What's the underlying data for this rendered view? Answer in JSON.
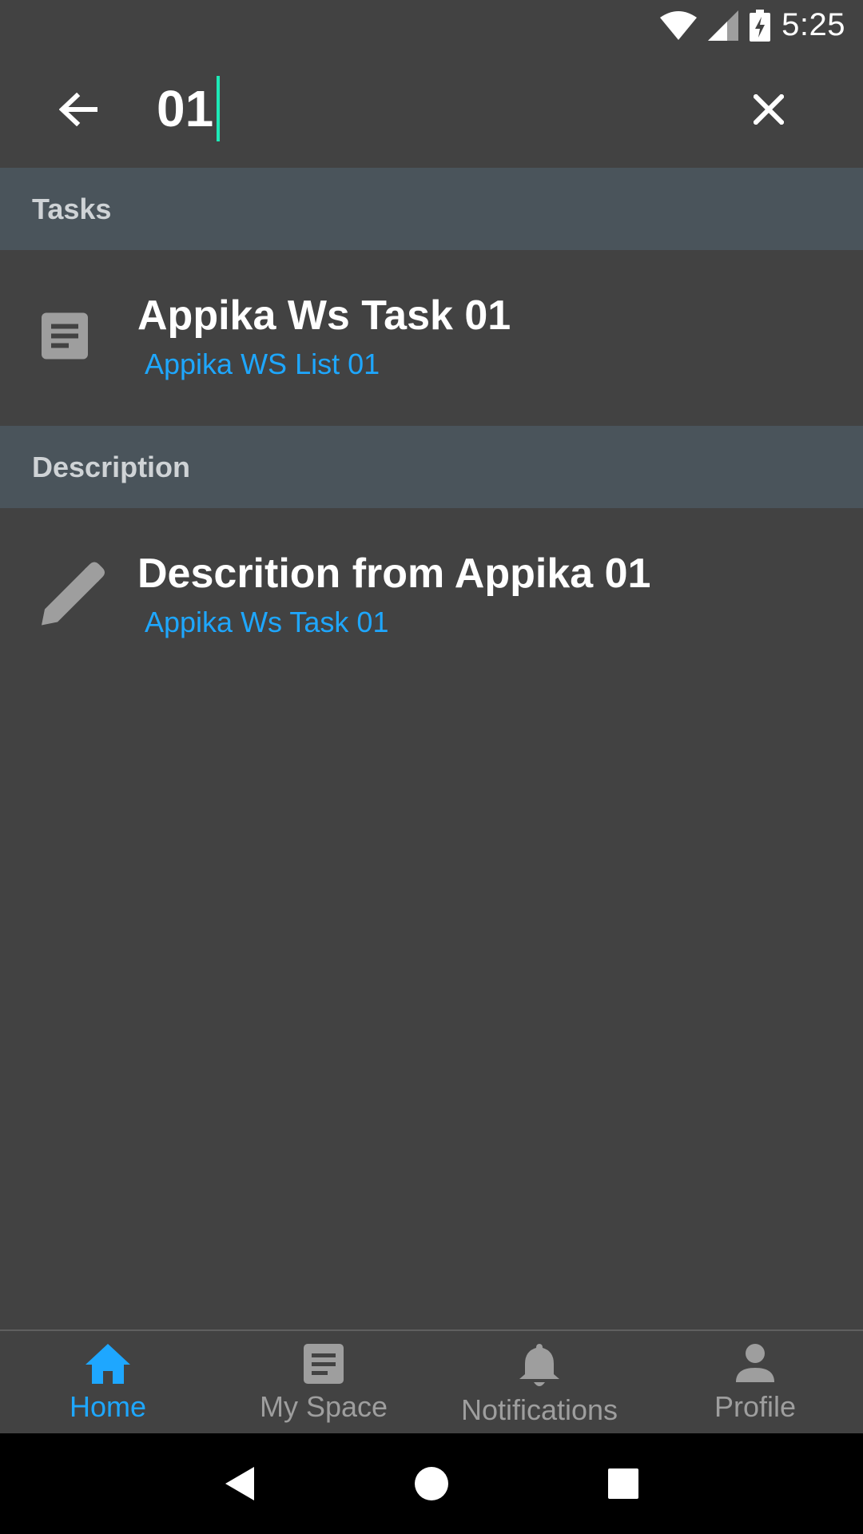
{
  "status_bar": {
    "time": "5:25"
  },
  "search": {
    "query": "01"
  },
  "sections": [
    {
      "header": "Tasks",
      "items": [
        {
          "title": "Appika Ws Task 01",
          "subtitle": "Appika WS List 01",
          "icon": "task-document-icon"
        }
      ]
    },
    {
      "header": "Description",
      "items": [
        {
          "title": "Descrition from Appika 01",
          "subtitle": "Appika Ws Task 01",
          "icon": "pencil-icon"
        }
      ]
    }
  ],
  "bottom_nav": {
    "items": [
      {
        "label": "Home",
        "icon": "home-icon",
        "active": true
      },
      {
        "label": "My Space",
        "icon": "document-icon",
        "active": false
      },
      {
        "label": "Notifications",
        "icon": "bell-icon",
        "active": false
      },
      {
        "label": "Profile",
        "icon": "person-icon",
        "active": false
      }
    ]
  },
  "colors": {
    "background": "#424242",
    "section_header": "#4a545b",
    "accent": "#1ea7ff",
    "caret": "#1de9b6",
    "inactive": "#9e9e9e"
  }
}
